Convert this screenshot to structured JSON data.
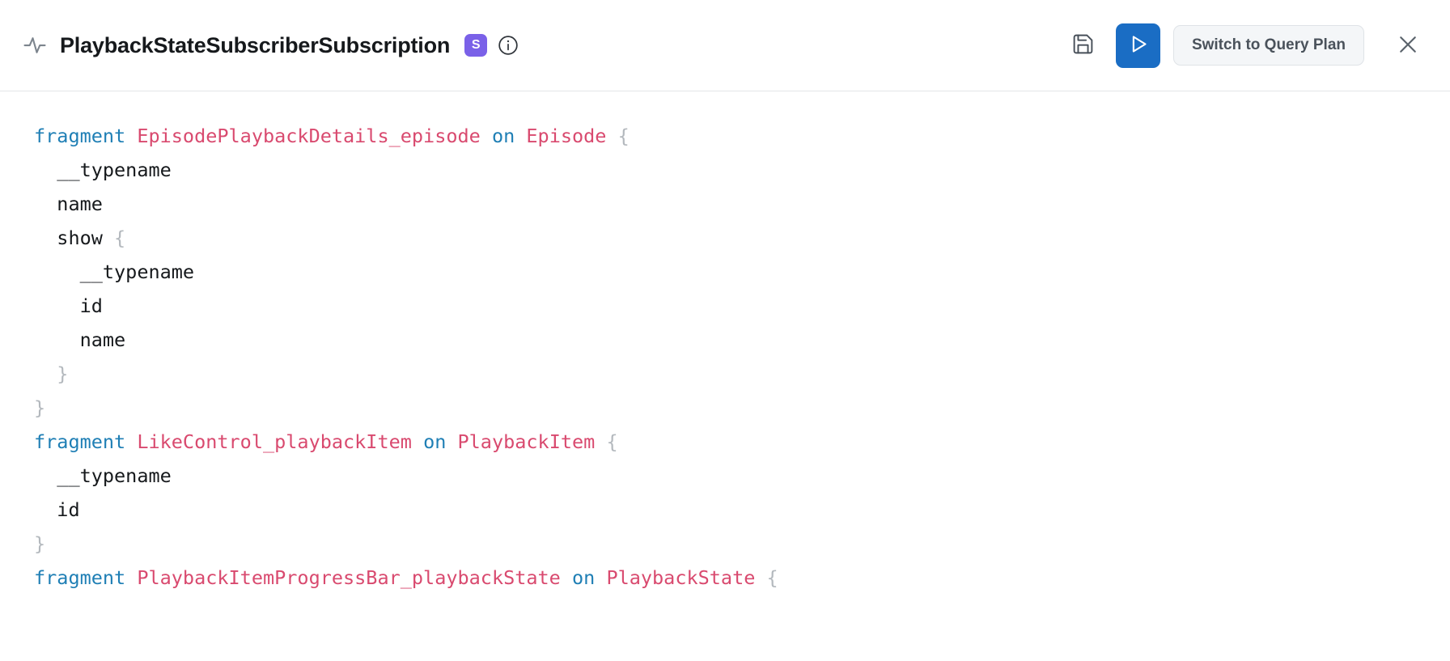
{
  "header": {
    "pulse_icon": "activity-pulse-icon",
    "title": "PlaybackStateSubscriberSubscription",
    "badge": "S",
    "badge_color": "#7a61e8",
    "info_icon": "info-circle-icon",
    "save_icon": "floppy-save-icon",
    "run_icon": "play-triangle-icon",
    "run_color": "#1a6dc4",
    "switch_label": "Switch to Query Plan",
    "close_icon": "close-x-icon"
  },
  "editor": {
    "language": "graphql",
    "lines": [
      [
        {
          "t": "fragment",
          "c": "kw"
        },
        {
          "t": " ",
          "c": "plain"
        },
        {
          "t": "EpisodePlaybackDetails_episode",
          "c": "name"
        },
        {
          "t": " ",
          "c": "plain"
        },
        {
          "t": "on",
          "c": "kw"
        },
        {
          "t": " ",
          "c": "plain"
        },
        {
          "t": "Episode",
          "c": "type"
        },
        {
          "t": " ",
          "c": "plain"
        },
        {
          "t": "{",
          "c": "punct"
        }
      ],
      [
        {
          "t": "  __typename",
          "c": "field"
        }
      ],
      [
        {
          "t": "  name",
          "c": "field"
        }
      ],
      [
        {
          "t": "  show",
          "c": "field"
        },
        {
          "t": " ",
          "c": "plain"
        },
        {
          "t": "{",
          "c": "punct"
        }
      ],
      [
        {
          "t": "    __typename",
          "c": "field"
        }
      ],
      [
        {
          "t": "    id",
          "c": "field"
        }
      ],
      [
        {
          "t": "    name",
          "c": "field"
        }
      ],
      [
        {
          "t": "  }",
          "c": "punct"
        }
      ],
      [
        {
          "t": "}",
          "c": "punct"
        }
      ],
      [
        {
          "t": "fragment",
          "c": "kw"
        },
        {
          "t": " ",
          "c": "plain"
        },
        {
          "t": "LikeControl_playbackItem",
          "c": "name"
        },
        {
          "t": " ",
          "c": "plain"
        },
        {
          "t": "on",
          "c": "kw"
        },
        {
          "t": " ",
          "c": "plain"
        },
        {
          "t": "PlaybackItem",
          "c": "type"
        },
        {
          "t": " ",
          "c": "plain"
        },
        {
          "t": "{",
          "c": "punct"
        }
      ],
      [
        {
          "t": "  __typename",
          "c": "field"
        }
      ],
      [
        {
          "t": "  id",
          "c": "field"
        }
      ],
      [
        {
          "t": "}",
          "c": "punct"
        }
      ],
      [
        {
          "t": "fragment",
          "c": "kw"
        },
        {
          "t": " ",
          "c": "plain"
        },
        {
          "t": "PlaybackItemProgressBar_playbackState",
          "c": "name"
        },
        {
          "t": " ",
          "c": "plain"
        },
        {
          "t": "on",
          "c": "kw"
        },
        {
          "t": " ",
          "c": "plain"
        },
        {
          "t": "PlaybackState",
          "c": "type"
        },
        {
          "t": " ",
          "c": "plain"
        },
        {
          "t": "{",
          "c": "punct"
        }
      ]
    ]
  }
}
